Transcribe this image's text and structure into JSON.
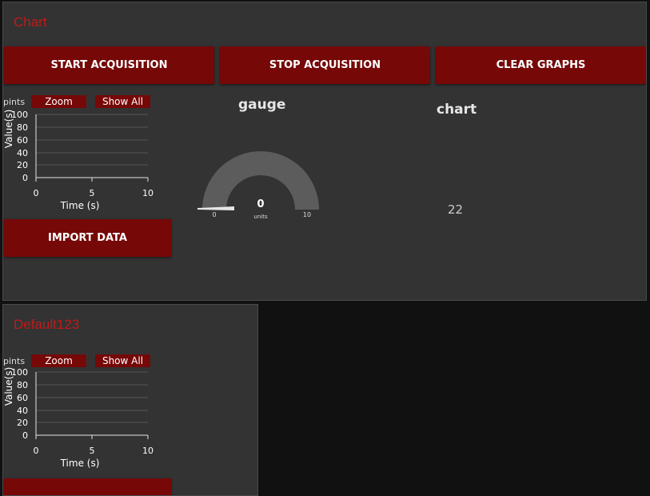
{
  "panels": {
    "chart": {
      "title": "Chart",
      "buttons": {
        "start": "START ACQUISITION",
        "stop": "STOP ACQUISITION",
        "clear": "CLEAR GRAPHS",
        "import": "IMPORT DATA"
      },
      "plot": {
        "zoom_label": "Zoom",
        "show_all_label": "Show All",
        "corner_label": "pints",
        "y_label": "Value(s)",
        "x_label": "Time (s)",
        "y_ticks": [
          "100",
          "80",
          "60",
          "40",
          "20",
          "0"
        ],
        "x_ticks": [
          "0",
          "5",
          "10"
        ]
      },
      "gauge": {
        "title": "gauge",
        "value": "0",
        "units": "units",
        "min": "0",
        "max": "10"
      },
      "text_widget": {
        "title": "chart",
        "value": "22"
      }
    },
    "default": {
      "title": "Default123",
      "plot": {
        "zoom_label": "Zoom",
        "show_all_label": "Show All",
        "corner_label": "pints",
        "y_label": "Value(s)",
        "x_label": "Time (s)",
        "y_ticks": [
          "100",
          "80",
          "60",
          "40",
          "20",
          "0"
        ],
        "x_ticks": [
          "0",
          "5",
          "10"
        ]
      }
    }
  },
  "colors": {
    "accent_red": "#760808",
    "title_red": "#c0191a",
    "panel_bg": "#333333",
    "page_bg": "#111111"
  }
}
